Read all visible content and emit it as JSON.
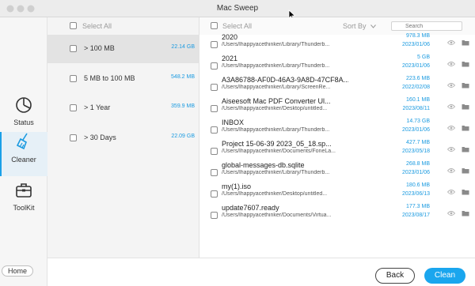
{
  "app": {
    "title": "Mac Sweep"
  },
  "sidebar": {
    "items": [
      {
        "label": "Status",
        "icon": "pie-chart-icon"
      },
      {
        "label": "Cleaner",
        "icon": "broom-icon",
        "active": true
      },
      {
        "label": "ToolKit",
        "icon": "toolbox-icon"
      }
    ],
    "home_label": "Home"
  },
  "categories": {
    "select_all_label": "Select All",
    "items": [
      {
        "label": "> 100 MB",
        "size": "22.14 GB",
        "selected": true
      },
      {
        "label": "5 MB to 100 MB",
        "size": "548.2 MB"
      },
      {
        "label": "> 1 Year",
        "size": "359.9 MB"
      },
      {
        "label": "> 30 Days",
        "size": "22.09 GB"
      }
    ]
  },
  "files": {
    "select_all_label": "Select All",
    "sort_label": "Sort By",
    "search_placeholder": "Search",
    "items": [
      {
        "name": "2020",
        "path": "/Users/lhappyacethinker/Library/Thunderb...",
        "size": "978.3 MB",
        "date": "2023/01/06"
      },
      {
        "name": "2021",
        "path": "/Users/lhappyacethinker/Library/Thunderb...",
        "size": "5 GB",
        "date": "2023/01/06"
      },
      {
        "name": "A3A86788-AF0D-46A3-9A8D-47CF8A...",
        "path": "/Users/lhappyacethinker/Library/ScreenRe...",
        "size": "223.6 MB",
        "date": "2022/02/08"
      },
      {
        "name": "Aiseesoft Mac PDF Converter Ul...",
        "path": "/Users/lhappyacethinker/Desktop/untitled...",
        "size": "160.1 MB",
        "date": "2023/08/11"
      },
      {
        "name": "INBOX",
        "path": "/Users/lhappyacethinker/Library/Thunderb...",
        "size": "14.73 GB",
        "date": "2023/01/06"
      },
      {
        "name": "Project 15-06-39 2023_05_18.sp...",
        "path": "/Users/lhappyacethinker/Documents/FoneLa...",
        "size": "427.7 MB",
        "date": "2023/05/18"
      },
      {
        "name": "global-messages-db.sqlite",
        "path": "/Users/lhappyacethinker/Library/Thunderb...",
        "size": "268.8 MB",
        "date": "2023/01/06"
      },
      {
        "name": "my(1).iso",
        "path": "/Users/lhappyacethinker/Desktop/untitled...",
        "size": "180.6 MB",
        "date": "2023/06/13"
      },
      {
        "name": "update7607.ready",
        "path": "/Users/lhappyacethinker/Documents/Virtua...",
        "size": "177.3 MB",
        "date": "2023/08/17"
      }
    ]
  },
  "footer": {
    "back_label": "Back",
    "clean_label": "Clean"
  },
  "colors": {
    "accent": "#1aa6ee",
    "size_text": "#1a9ae0"
  }
}
